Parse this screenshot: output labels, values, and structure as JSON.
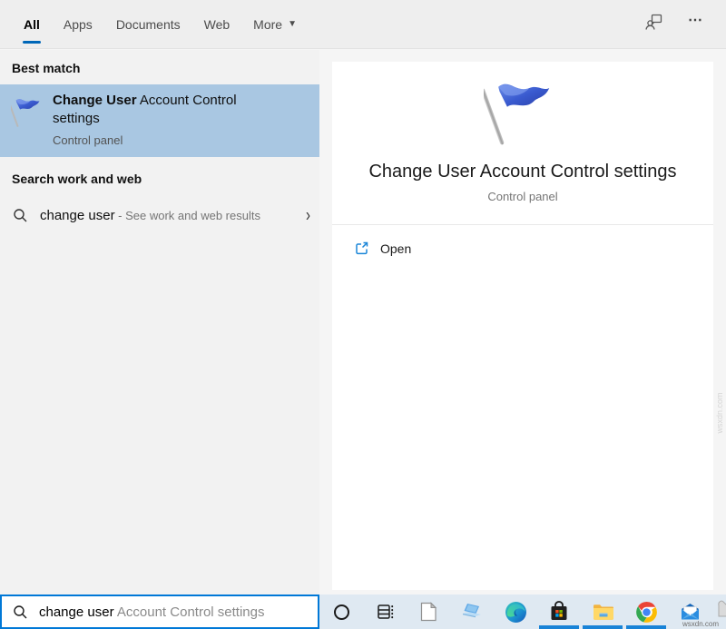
{
  "colors": {
    "accent": "#0078d7",
    "tab_underline": "#0067b8",
    "best_match_highlight": "#a9c7e2",
    "taskbar_bg": "#dfe9f2",
    "left_panel_bg": "#f2f2f2",
    "topbar_bg": "#eeeeee"
  },
  "tabs": {
    "items": [
      {
        "label": "All",
        "active": true
      },
      {
        "label": "Apps",
        "active": false
      },
      {
        "label": "Documents",
        "active": false
      },
      {
        "label": "Web",
        "active": false
      },
      {
        "label": "More",
        "active": false
      }
    ],
    "more_caret": "▼",
    "right_icons": [
      "feedback-icon",
      "more-options-ellipsis"
    ]
  },
  "left_panel": {
    "best_match_header": "Best match",
    "best_match": {
      "title_bold": "Change User",
      "title_rest": " Account Control settings",
      "subtitle": "Control panel",
      "icon": "uac-flag-icon"
    },
    "search_web_header": "Search work and web",
    "web_suggestion": {
      "query": "change user",
      "hint": " - See work and web results",
      "chevron": "›"
    }
  },
  "preview": {
    "icon": "uac-flag-icon",
    "title": "Change User Account Control settings",
    "subtitle": "Control panel",
    "actions": [
      {
        "label": "Open",
        "icon": "launch-icon"
      }
    ]
  },
  "search_bar": {
    "typed": "change user",
    "suggestion": " Account Control settings",
    "icon": "search-icon"
  },
  "taskbar": {
    "icons": [
      "cortana",
      "task-view",
      "document",
      "laptop",
      "edge",
      "microsoft-store",
      "file-explorer",
      "chrome",
      "mail",
      "cut-off-icon"
    ],
    "running_underlined": [
      "microsoft-store",
      "file-explorer",
      "chrome"
    ]
  },
  "watermark": {
    "text": "wsxdn.com"
  },
  "ellipsis_glyph": "⋯"
}
